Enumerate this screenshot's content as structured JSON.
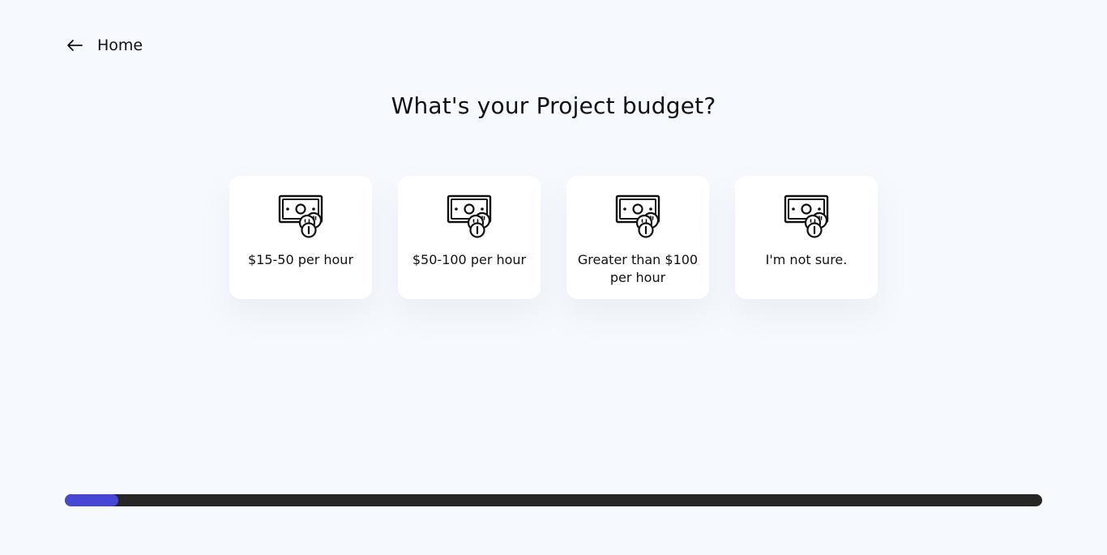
{
  "header": {
    "back_label": "Home"
  },
  "question": {
    "title": "What's your Project budget?"
  },
  "options": [
    {
      "label": "$15-50 per hour",
      "icon": "money-cash-coins-icon"
    },
    {
      "label": "$50-100 per hour",
      "icon": "money-cash-coins-icon"
    },
    {
      "label": "Greater than $100 per hour",
      "icon": "money-cash-coins-icon"
    },
    {
      "label": "I'm not sure.",
      "icon": "money-cash-coins-icon"
    }
  ],
  "progress": {
    "value": 0.055,
    "fill_color": "#4747d6",
    "track_color": "#262624"
  }
}
